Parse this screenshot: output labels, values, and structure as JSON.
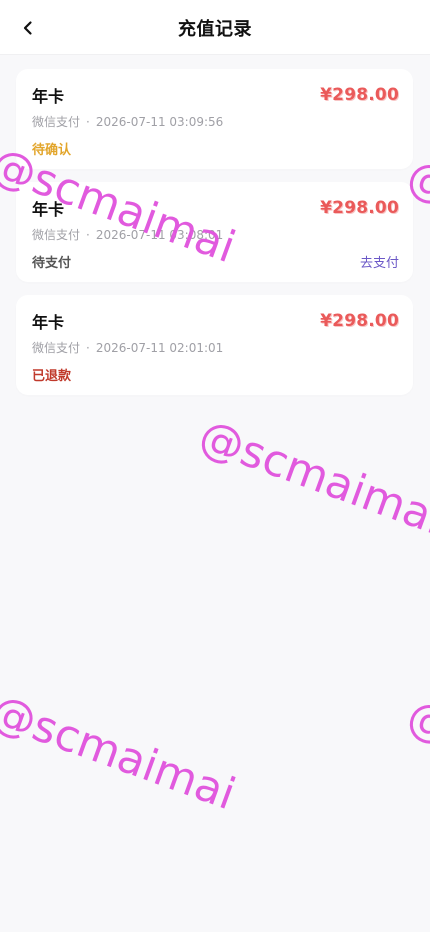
{
  "header": {
    "title": "充值记录",
    "back_icon": "chevron-left-icon"
  },
  "records": [
    {
      "title": "年卡",
      "amount": "¥298.00",
      "payment_method": "微信支付",
      "separator": "·",
      "datetime": "2026-07-11 03:09:56",
      "status": "待确认",
      "status_color": "#e2a52b",
      "action": ""
    },
    {
      "title": "年卡",
      "amount": "¥298.00",
      "payment_method": "微信支付",
      "separator": "·",
      "datetime": "2026-07-11 03:08:01",
      "status": "待支付",
      "status_color": "#555555",
      "action": "去支付"
    },
    {
      "title": "年卡",
      "amount": "¥298.00",
      "payment_method": "微信支付",
      "separator": "·",
      "datetime": "2026-07-11 02:01:01",
      "status": "已退款",
      "status_color": "#c0392b",
      "action": ""
    }
  ],
  "watermark": {
    "text": "@scmaimai",
    "color": "#e052dd"
  },
  "colors": {
    "amount": "#ea5a5a",
    "action": "#6b58c7",
    "background": "#f8f8fa"
  }
}
